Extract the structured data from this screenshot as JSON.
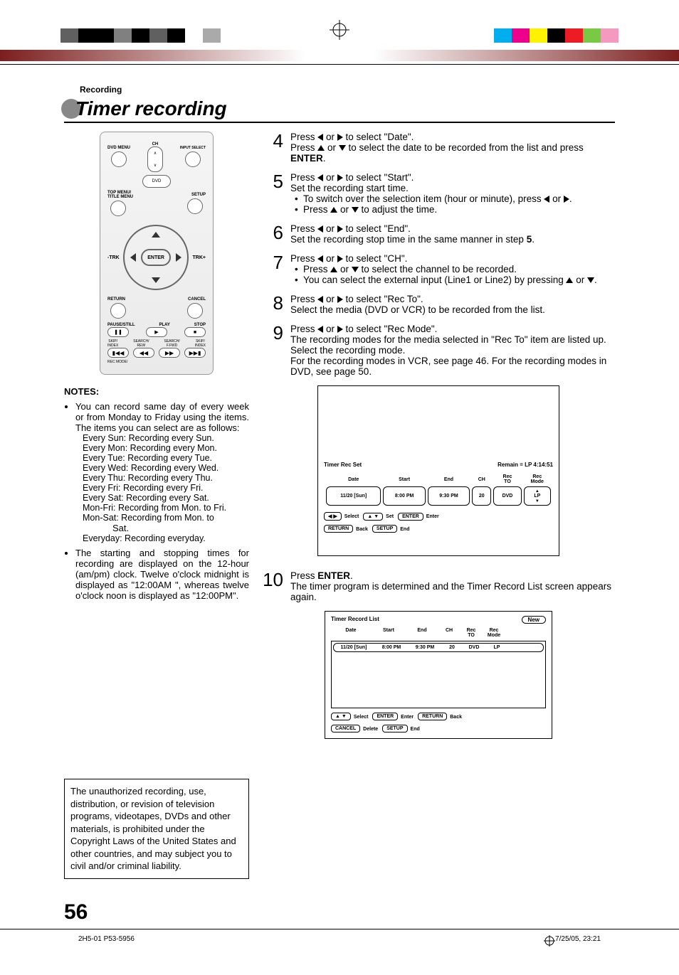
{
  "header": {
    "section": "Recording",
    "title": "Timer recording"
  },
  "remote": {
    "dvdmenu": "DVD MENU",
    "ch": "CH",
    "input": "INPUT SELECT",
    "dvd": "DVD",
    "topmenu": "TOP MENU/\nTITLE MENU",
    "setup": "SETUP",
    "trk_minus": "-TRK",
    "enter": "ENTER",
    "trk_plus": "TRK+",
    "return": "RETURN",
    "cancel": "CANCEL",
    "pause": "PAUSE/STILL",
    "play": "PLAY",
    "stop": "STOP",
    "skip_index_l": "SKIP/\nINDEX",
    "search_rew": "SEARCH/\nREW",
    "search_ff": "SEARCH/\nF.FWD",
    "skip_index_r": "SKIP/\nINDEX",
    "recmode": "REC MODE/"
  },
  "notes": {
    "title": "NOTES:",
    "bullet1_intro": "You can record same day of every week or from Monday to Friday using the items. The items you can select are as follows:",
    "schedule": [
      "Every Sun: Recording every Sun.",
      "Every  Mon: Recording every Mon.",
      "Every  Tue: Recording every Tue.",
      "Every Wed: Recording every Wed.",
      "Every  Thu: Recording every Thu.",
      "Every  Fri: Recording every Fri.",
      "Every  Sat: Recording every Sat.",
      "Mon-Fri: Recording from Mon. to Fri."
    ],
    "monsat_l1": "Mon-Sat: Recording from Mon. to",
    "monsat_l2": "Sat.",
    "everyday": "Everyday: Recording everyday.",
    "bullet2": "The starting and stopping times for recording are displayed on the 12-hour (am/pm) clock. Twelve o'clock midnight is displayed as \"12:00AM \", whereas twelve o'clock noon is displayed as \"12:00PM\"."
  },
  "legal": "The unauthorized recording, use, distribution, or revision of television programs, videotapes, DVDs and other materials, is prohibited under the Copyright Laws of the United States and other countries, and may subject you to civil and/or criminal liability.",
  "steps": {
    "s4": {
      "num": "4",
      "l1a": "Press ",
      "l1b": " or ",
      "l1c": " to select \"Date\".",
      "l2a": "Press ",
      "l2b": " or ",
      "l2c": " to select the date to be recorded from the list and press ",
      "enter": "ENTER",
      "l2d": "."
    },
    "s5": {
      "num": "5",
      "l1a": "Press ",
      "l1b": " or ",
      "l1c": " to select \"Start\".",
      "l2": "Set the recording start time.",
      "b1a": "To switch over the selection item (hour or minute), press ",
      "b1b": " or ",
      "b1c": ".",
      "b2a": "Press ",
      "b2b": " or ",
      "b2c": " to adjust the time."
    },
    "s6": {
      "num": "6",
      "l1a": "Press ",
      "l1b": " or ",
      "l1c": " to select \"End\".",
      "l2": "Set the recording stop time in the same manner in step ",
      "five": "5",
      "l2b": "."
    },
    "s7": {
      "num": "7",
      "l1a": "Press ",
      "l1b": " or ",
      "l1c": " to select \"CH\".",
      "b1a": "Press ",
      "b1b": " or ",
      "b1c": " to select the channel to be recorded.",
      "b2a": "You can select the external input (Line1 or Line2) by pressing ",
      "b2b": " or ",
      "b2c": "."
    },
    "s8": {
      "num": "8",
      "l1a": "Press ",
      "l1b": " or ",
      "l1c": " to select \"Rec To\".",
      "l2": "Select the media (DVD or VCR) to be recorded from the list."
    },
    "s9": {
      "num": "9",
      "l1a": " Press ",
      "l1b": " or ",
      "l1c": " to select \"Rec Mode\".",
      "l2": "The recording modes for the media selected in \"Rec To\" item are listed up.",
      "l3": "Select the recording mode.",
      "l4": "For the recording modes in VCR, see page 46. For the recording modes in DVD, see page 50."
    },
    "s10": {
      "num": "10",
      "l1a": "Press ",
      "enter": "ENTER",
      "l1b": ".",
      "l2": "The timer program is determined and the Timer Record List screen appears again."
    }
  },
  "osd1": {
    "title": "Timer Rec Set",
    "remain": "Remain = LP 4:14:51",
    "headers": {
      "date": "Date",
      "start": "Start",
      "end": "End",
      "ch": "CH",
      "recto": "Rec\nTO",
      "recmode": "Rec\nMode"
    },
    "row": {
      "date": "11/20 [Sun]",
      "start": "8:00 PM",
      "end": "9:30 PM",
      "ch": "20",
      "recto": "DVD",
      "recmode": "LP"
    },
    "foot": {
      "lr": "◀ ▶",
      "select": "Select",
      "ud": "▲ ▼",
      "set": "Set",
      "enter_k": "ENTER",
      "enter_l": "Enter",
      "return_k": "RETURN",
      "back": "Back",
      "setup_k": "SETUP",
      "end": "End"
    }
  },
  "osd2": {
    "title": "Timer Record List",
    "new": "New",
    "headers": {
      "date": "Date",
      "start": "Start",
      "end": "End",
      "ch": "CH",
      "recto": "Rec\nTO",
      "recmode": "Rec\nMode"
    },
    "row": {
      "date": "11/20 [Sun]",
      "start": "8:00 PM",
      "end": "9:30 PM",
      "ch": "20",
      "recto": "DVD",
      "recmode": "LP"
    },
    "foot": {
      "ud": "▲ ▼",
      "select": "Select",
      "enter_k": "ENTER",
      "enter_l": "Enter",
      "return_k": "RETURN",
      "back": "Back",
      "cancel_k": "CANCEL",
      "delete": "Delete",
      "setup_k": "SETUP",
      "end": "End"
    }
  },
  "footer": {
    "page_big": "56",
    "job": "2H5-01 P53-59",
    "folio": "56",
    "ts": "7/25/05, 23:21"
  }
}
